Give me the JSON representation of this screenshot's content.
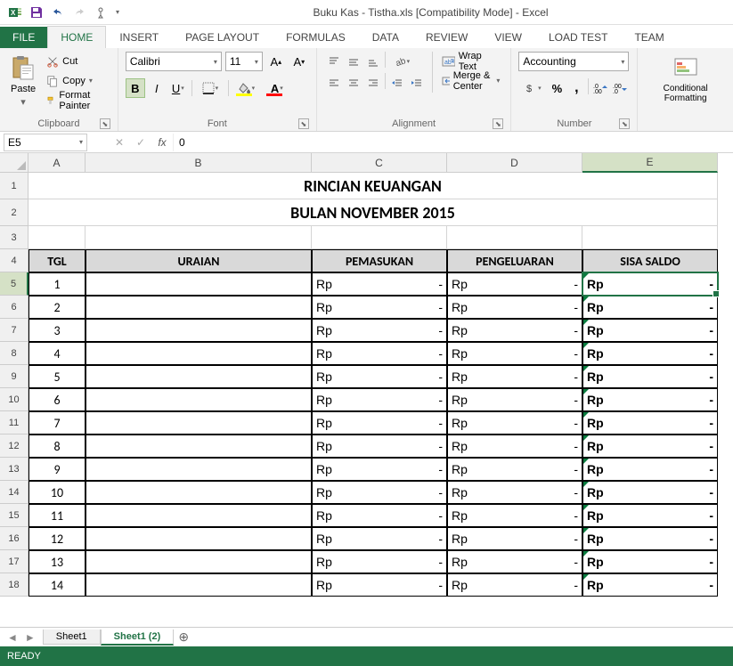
{
  "title": "Buku Kas - Tistha.xls  [Compatibility Mode] - Excel",
  "tabs": {
    "file": "FILE",
    "home": "HOME",
    "insert": "INSERT",
    "pagelayout": "PAGE LAYOUT",
    "formulas": "FORMULAS",
    "data": "DATA",
    "review": "REVIEW",
    "view": "VIEW",
    "loadtest": "LOAD TEST",
    "team": "TEAM"
  },
  "ribbon": {
    "clipboard": {
      "paste": "Paste",
      "cut": "Cut",
      "copy": "Copy",
      "fmt": "Format Painter",
      "label": "Clipboard"
    },
    "font": {
      "name": "Calibri",
      "size": "11",
      "label": "Font"
    },
    "alignment": {
      "wrap": "Wrap Text",
      "merge": "Merge & Center",
      "label": "Alignment"
    },
    "number": {
      "format": "Accounting",
      "label": "Number"
    },
    "styles": {
      "cond": "Conditional Formatting"
    }
  },
  "namebox": "E5",
  "formula": "0",
  "cols": [
    "A",
    "B",
    "C",
    "D",
    "E"
  ],
  "sheet": {
    "title1": "RINCIAN KEUANGAN",
    "title2": "BULAN NOVEMBER 2015",
    "headers": {
      "tgl": "TGL",
      "uraian": "URAIAN",
      "pemasukan": "PEMASUKAN",
      "pengeluaran": "PENGELUARAN",
      "sisa": "SISA SALDO"
    },
    "rp": "Rp",
    "dash": "-",
    "rows": [
      "1",
      "2",
      "3",
      "4",
      "5",
      "6",
      "7",
      "8",
      "9",
      "10",
      "11",
      "12",
      "13",
      "14"
    ]
  },
  "sheets": {
    "s1": "Sheet1",
    "s2": "Sheet1 (2)"
  },
  "status": "READY"
}
